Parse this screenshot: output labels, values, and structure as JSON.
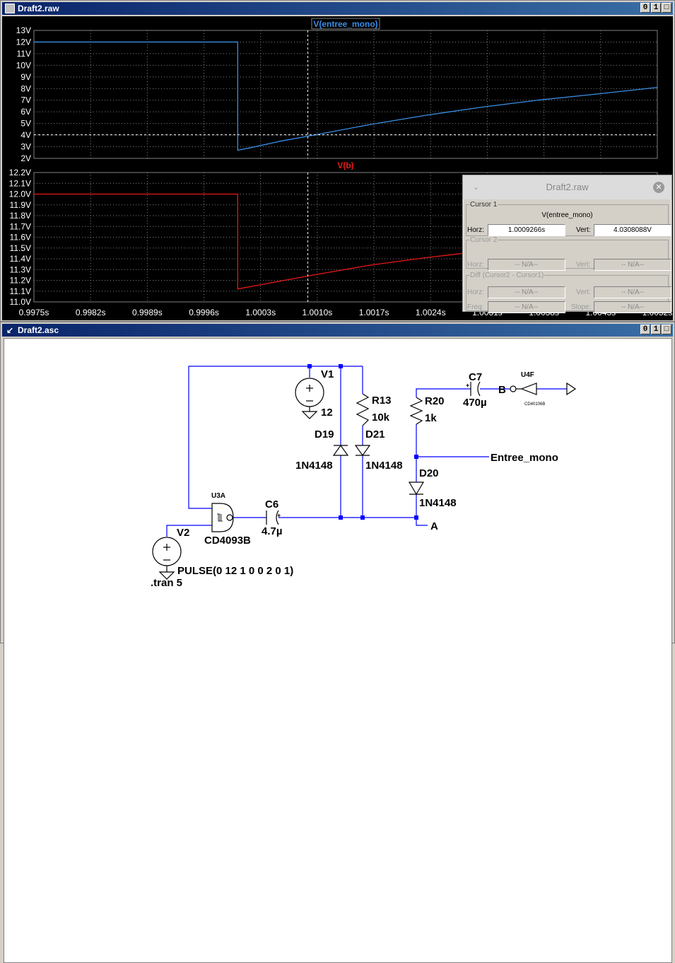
{
  "waveform_window": {
    "title": "Draft2.raw",
    "buttons": [
      "0",
      "1",
      "□"
    ],
    "colors": {
      "bg": "#000000",
      "grid": "#808080",
      "trace1": "#3a8ee6",
      "trace2": "#e81818",
      "axis_text": "#ffffff"
    }
  },
  "chart_data": [
    {
      "type": "line",
      "title": "V(entree_mono)",
      "y_ticks": [
        "13V",
        "12V",
        "11V",
        "10V",
        "9V",
        "8V",
        "7V",
        "6V",
        "5V",
        "4V",
        "3V",
        "2V"
      ],
      "ylim": [
        2,
        13
      ],
      "xlim": [
        0.9975,
        1.0053
      ],
      "series": [
        {
          "name": "V(entree_mono)",
          "color": "#3a8ee6",
          "x": [
            0.9975,
            1.00005,
            1.00005,
            1.0002,
            1.0006,
            1.001,
            1.0017,
            1.0024,
            1.0031,
            1.0038,
            1.0045,
            1.0053
          ],
          "values": [
            12,
            12,
            2.7,
            2.9,
            3.5,
            4.0,
            4.9,
            5.7,
            6.4,
            7.0,
            7.5,
            8.1
          ]
        }
      ]
    },
    {
      "type": "line",
      "title": "V(b)",
      "y_ticks": [
        "12.2V",
        "12.1V",
        "12.0V",
        "11.9V",
        "11.8V",
        "11.7V",
        "11.6V",
        "11.5V",
        "11.4V",
        "11.3V",
        "11.2V",
        "11.1V",
        "11.0V"
      ],
      "ylim": [
        11.0,
        12.2
      ],
      "xlim": [
        0.9975,
        1.0053
      ],
      "x_ticks": [
        "0.9975s",
        "0.9982s",
        "0.9989s",
        "0.9996s",
        "1.0003s",
        "1.0010s",
        "1.0017s",
        "1.0024s",
        "1.0031s",
        "1.0038s",
        "1.0045s",
        "1.0052s"
      ],
      "series": [
        {
          "name": "V(b)",
          "color": "#e81818",
          "x": [
            0.9975,
            1.00005,
            1.00005,
            1.001,
            1.0017,
            1.0024,
            1.0031
          ],
          "values": [
            12.0,
            12.0,
            11.12,
            11.25,
            11.34,
            11.41,
            11.47
          ]
        }
      ]
    }
  ],
  "cursor": {
    "x": 1.0009266,
    "y": 4.0308088
  },
  "cursor_dialog": {
    "title": "Draft2.raw",
    "cursor1": {
      "legend": "Cursor 1",
      "signal": "V(entree_mono)",
      "horz_label": "Horz:",
      "horz": "1.0009266s",
      "vert_label": "Vert:",
      "vert": "4.0308088V"
    },
    "cursor2": {
      "legend": "Cursor 2",
      "horz_label": "Horz:",
      "horz": "-- N/A--",
      "vert_label": "Vert:",
      "vert": "-- N/A--"
    },
    "diff": {
      "legend": "Diff (Cursor2 - Cursor1)",
      "horz_label": "Horz:",
      "horz": "-- N/A--",
      "vert_label": "Vert:",
      "vert": "-- N/A--",
      "freq_label": "Freq:",
      "freq": "-- N/A--",
      "slope_label": "Slope:",
      "slope": "-- N/A--"
    }
  },
  "schematic_window": {
    "title": "Draft2.asc",
    "buttons": [
      "0",
      "1",
      "□"
    ],
    "colors": {
      "wire": "#0000ff",
      "part": "#000000",
      "bg": "#ffffff"
    },
    "labels": {
      "v1": "V1",
      "v1_val": "12",
      "v2": "V2",
      "v2_val": "PULSE(0 12 1 0 0 2 0 1)",
      "tran": ".tran 5",
      "u3a": "U3A",
      "u3a_part": "CD4093B",
      "c6": "C6",
      "c6_val": "4.7µ",
      "r13": "R13",
      "r13_val": "10k",
      "d19": "D19",
      "d19_val": "1N4148",
      "d21": "D21",
      "d21_val": "1N4148",
      "r20": "R20",
      "r20_val": "1k",
      "c7": "C7",
      "c7_val": "470µ",
      "d20": "D20",
      "d20_val": "1N4148",
      "u4f": "U4F",
      "u4f_part": "CD40106B",
      "net_b": "B",
      "net_a": "A",
      "net_entree": "Entree_mono"
    }
  }
}
